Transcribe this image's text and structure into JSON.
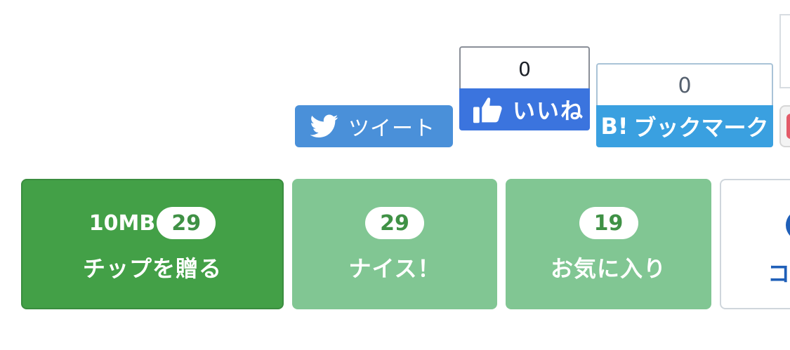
{
  "share": {
    "twitter": {
      "label": "ツイート",
      "icon": "twitter-bird-icon",
      "color": "#4a90d9"
    },
    "facebook": {
      "count": "0",
      "label": "いいね",
      "icon": "thumbs-up-icon",
      "color": "#3b74de"
    },
    "hatena": {
      "count": "0",
      "logo": "B!",
      "label": "ブックマーク",
      "color": "#3aa0e0"
    }
  },
  "actions": {
    "tip": {
      "size": "10MB",
      "count": "29",
      "label": "チップを贈る",
      "color": "#43a047"
    },
    "nice": {
      "count": "29",
      "label": "ナイス！",
      "color": "#81c693"
    },
    "favorite": {
      "count": "19",
      "label": "お気に入り",
      "color": "#81c693"
    },
    "comment": {
      "label": "コ",
      "color": "#1f5fb8"
    }
  }
}
